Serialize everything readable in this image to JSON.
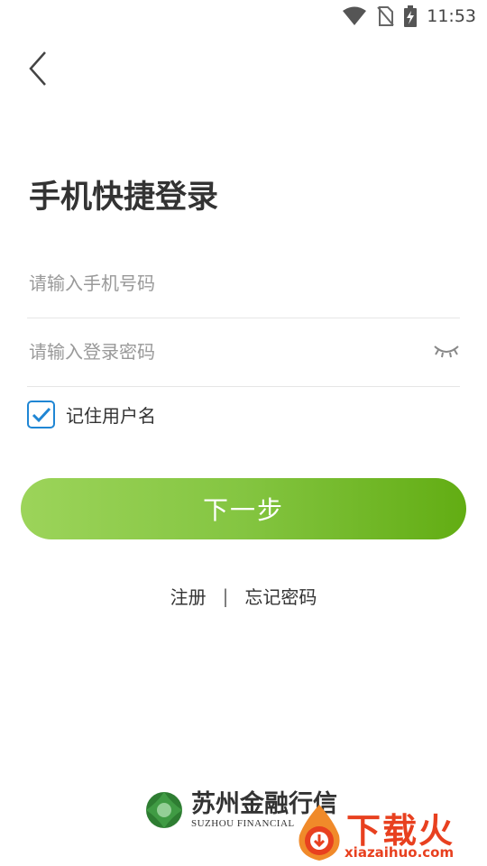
{
  "status_bar": {
    "time": "11:53"
  },
  "header": {
    "title": "手机快捷登录"
  },
  "form": {
    "phone_placeholder": "请输入手机号码",
    "password_placeholder": "请输入登录密码",
    "remember_label": "记住用户名",
    "remember_checked": true,
    "next_button": "下一步"
  },
  "links": {
    "register": "注册",
    "separator": "|",
    "forgot": "忘记密码"
  },
  "footer": {
    "brand_cn": "苏州金融行信",
    "brand_en": "SUZHOU FINANCIAL"
  },
  "watermark": {
    "text_cn": "下载火",
    "text_en": "xiazaihuo.com"
  },
  "colors": {
    "accent_green_start": "#9cd45a",
    "accent_green_end": "#62ad13",
    "checkbox_blue": "#1f86d4",
    "watermark_red": "#e8401f"
  }
}
